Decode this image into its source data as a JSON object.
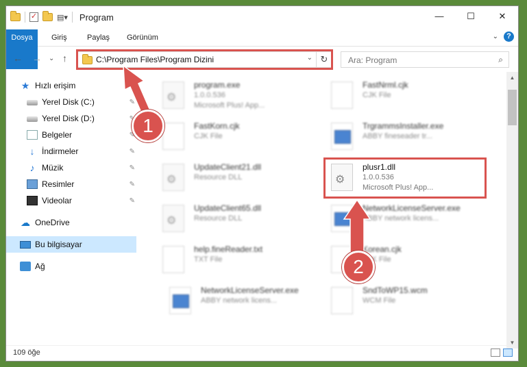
{
  "window": {
    "title": "Program",
    "controls": {
      "minimize": "—",
      "maximize": "☐",
      "close": "✕"
    }
  },
  "ribbon": {
    "tabs": [
      "Dosya",
      "Giriş",
      "Paylaş",
      "Görünüm"
    ],
    "expand_glyph": "⌄",
    "help_glyph": "?"
  },
  "address_bar": {
    "path": "C:\\Program Files\\Program Dizini",
    "dropdown_glyph": "⌄",
    "refresh_glyph": "↻"
  },
  "search": {
    "placeholder": "Ara: Program",
    "icon_glyph": "⌕"
  },
  "nav_buttons": {
    "back": "←",
    "forward": "→",
    "recent": "⌄",
    "up": "↑"
  },
  "sidebar": {
    "quick_access": "Hızlı erişim",
    "items": [
      {
        "label": "Yerel Disk (C:)",
        "icon": "disk-icon",
        "pin": "📌"
      },
      {
        "label": "Yerel Disk (D:)",
        "icon": "disk-icon",
        "pin": "📌"
      },
      {
        "label": "Belgeler",
        "icon": "documents-icon",
        "pin": "📌"
      },
      {
        "label": "İndirmeler",
        "icon": "download-icon",
        "pin": "📌"
      },
      {
        "label": "Müzik",
        "icon": "music-icon",
        "pin": "📌"
      },
      {
        "label": "Resimler",
        "icon": "pictures-icon",
        "pin": "📌"
      },
      {
        "label": "Videolar",
        "icon": "videos-icon",
        "pin": "📌"
      }
    ],
    "onedrive": "OneDrive",
    "this_pc": "Bu bilgisayar",
    "network": "Ağ"
  },
  "files": [
    {
      "name": "program.exe",
      "meta1": "1.0.0.536",
      "meta2": "Microsoft Plus! App...",
      "icon": "gear"
    },
    {
      "name": "FastNrml.cjk",
      "meta1": "CJK File",
      "meta2": "",
      "icon": "page"
    },
    {
      "name": "FastKorn.cjk",
      "meta1": "CJK File",
      "meta2": "",
      "icon": "page"
    },
    {
      "name": "TrgrammsInstaller.exe",
      "meta1": "ABBY fineseader tr...",
      "meta2": "",
      "icon": "exe"
    },
    {
      "name": "UpdateClient21.dll",
      "meta1": "Resource DLL",
      "meta2": "",
      "icon": "gear"
    },
    {
      "name": "plusr1.dll",
      "meta1": "1.0.0.536",
      "meta2": "Microsoft Plus! App...",
      "icon": "gear"
    },
    {
      "name": "UpdateClient65.dll",
      "meta1": "Resource DLL",
      "meta2": "",
      "icon": "gear"
    },
    {
      "name": "NetworkLicenseServer.exe",
      "meta1": "ABBY network licens...",
      "meta2": "",
      "icon": "exe"
    },
    {
      "name": "help.fineReader.txt",
      "meta1": "TXT File",
      "meta2": "",
      "icon": "page"
    },
    {
      "name": "Korean.cjk",
      "meta1": "CJK File",
      "meta2": "",
      "icon": "page"
    },
    {
      "name": "NetworkLicenseServer.exe",
      "meta1": "ABBY network licens...",
      "meta2": "",
      "icon": "exe"
    },
    {
      "name": "SndToWP15.wcm",
      "meta1": "WCM File",
      "meta2": "",
      "icon": "page"
    }
  ],
  "status_bar": {
    "item_count": "109 öğe"
  },
  "annotations": {
    "step1": "1",
    "step2": "2",
    "color": "#d9534f"
  }
}
